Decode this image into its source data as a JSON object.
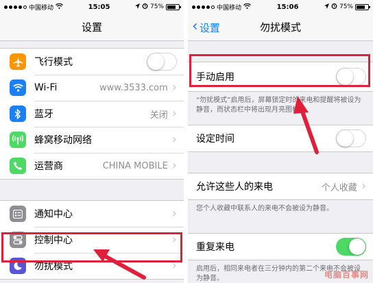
{
  "left": {
    "status": {
      "carrier": "中国移动",
      "time": "15:05",
      "battery": "75%",
      "battery_level": 0.75
    },
    "title": "设置",
    "group1": [
      {
        "label": "飞行模式",
        "icon": "airplane-icon",
        "color": "#ff9500",
        "control": "toggle",
        "on": false
      },
      {
        "label": "Wi-Fi",
        "icon": "wifi-icon",
        "color": "#1b7ff6",
        "value": "www.3533.com"
      },
      {
        "label": "蓝牙",
        "icon": "bluetooth-icon",
        "color": "#1b7ff6",
        "value": "关闭"
      },
      {
        "label": "蜂窝移动网络",
        "icon": "cellular-icon",
        "color": "#4cd964"
      },
      {
        "label": "运营商",
        "icon": "phone-icon",
        "color": "#4cd964",
        "value": "CHINA MOBILE"
      }
    ],
    "group2": [
      {
        "label": "通知中心",
        "icon": "notification-center-icon",
        "color": "#8e8e93"
      },
      {
        "label": "控制中心",
        "icon": "control-center-icon",
        "color": "#8e8e93"
      },
      {
        "label": "勿扰模式",
        "icon": "moon-icon",
        "color": "#5856d6"
      }
    ]
  },
  "right": {
    "status": {
      "carrier": "中国移动",
      "time": "15:06",
      "battery": "75%",
      "battery_level": 0.75
    },
    "back_label": "设置",
    "title": "勿扰模式",
    "manual": {
      "label": "手动启用",
      "on": false
    },
    "manual_footer": "“勿扰模式”启用后，屏幕锁定时的来电和提醒将被设为静音，而状态栏中将出现月亮图标。",
    "scheduled": {
      "label": "设定时间",
      "on": false
    },
    "allow": {
      "label": "允许这些人的来电",
      "value": "个人收藏"
    },
    "allow_footer": "您个人收藏中联系人的来电不会被设为静音。",
    "repeat": {
      "label": "重复来电",
      "on": true
    },
    "repeat_footer": "启用后，相同来电者在三分钟内的第二个来电不会被设为静音。"
  },
  "colors": {
    "accent": "#1b7ff6",
    "highlight": "#e0203a",
    "switch_on": "#4cd964"
  },
  "watermark": "电脑百事网"
}
